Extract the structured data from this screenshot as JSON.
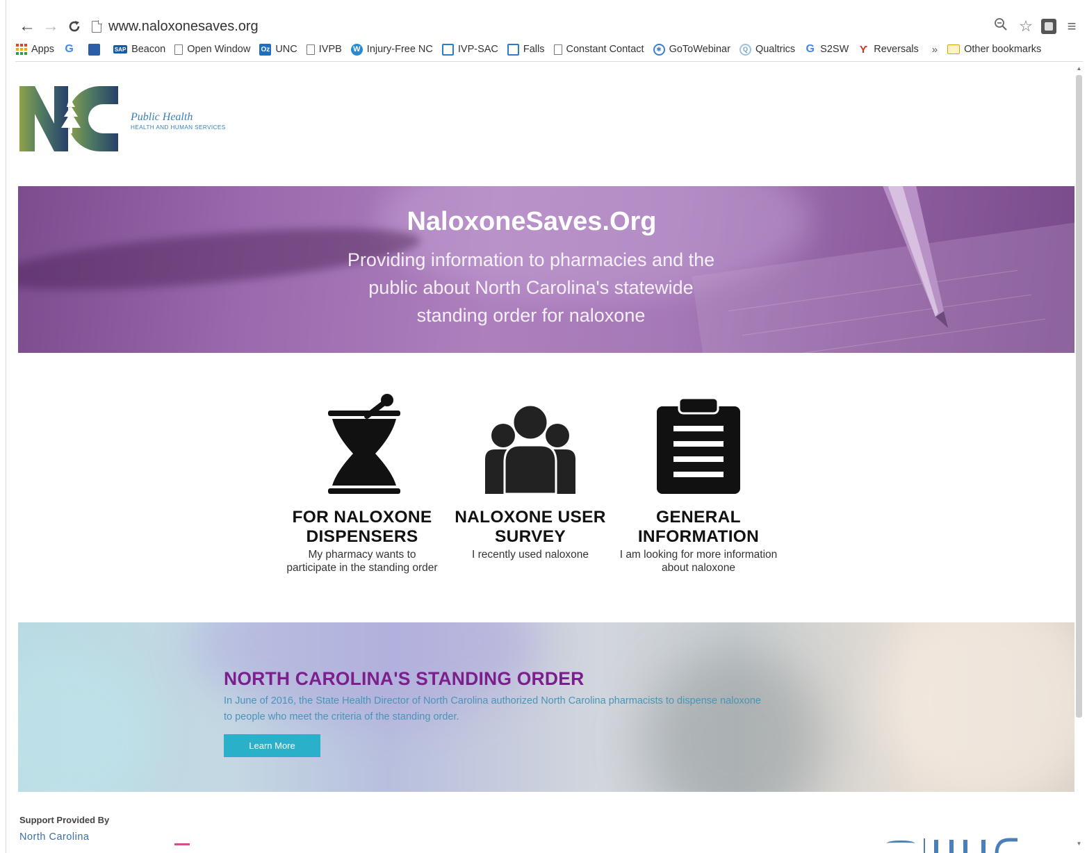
{
  "browser": {
    "url": "www.naloxonesaves.org",
    "bookmarks": [
      {
        "label": "Apps",
        "icon": "apps-grid-icon",
        "color": "#e0452c"
      },
      {
        "label": "",
        "icon": "google-icon",
        "color": "#4285f4"
      },
      {
        "label": "",
        "icon": "news-site-icon",
        "color": "#2a5fa8"
      },
      {
        "label": "Beacon",
        "icon": "sap-icon",
        "color": "#1a5aa0"
      },
      {
        "label": "Open Window",
        "icon": "page-icon",
        "color": "#777777"
      },
      {
        "label": "UNC",
        "icon": "outlook-icon",
        "color": "#1f6fc1"
      },
      {
        "label": "IVPB",
        "icon": "page-icon",
        "color": "#777777"
      },
      {
        "label": "Injury-Free NC",
        "icon": "wordpress-icon",
        "color": "#2a8ad0"
      },
      {
        "label": "IVP-SAC",
        "icon": "calendar-icon",
        "color": "#2b7bd0"
      },
      {
        "label": "Falls",
        "icon": "calendar-icon",
        "color": "#2b7bd0"
      },
      {
        "label": "Constant Contact",
        "icon": "page-icon",
        "color": "#777777"
      },
      {
        "label": "GoToWebinar",
        "icon": "gotowebinar-icon",
        "color": "#3b7fd0"
      },
      {
        "label": "Qualtrics",
        "icon": "qualtrics-icon",
        "color": "#6aa0d8"
      },
      {
        "label": "S2SW",
        "icon": "google-icon",
        "color": "#4285f4"
      },
      {
        "label": "Reversals",
        "icon": "reversals-icon",
        "color": "#d03020"
      }
    ],
    "more_label": "»",
    "other_bookmarks_label": "Other bookmarks"
  },
  "header": {
    "logo_title": "Public Health",
    "logo_subtitle": "HEALTH AND HUMAN SERVICES"
  },
  "hero": {
    "title": "NaloxoneSaves.Org",
    "subtitle": "Providing information to pharmacies and the public about North Carolina's statewide standing order for naloxone"
  },
  "options": [
    {
      "title": "FOR NALOXONE DISPENSERS",
      "description": "My pharmacy wants to participate in the standing order",
      "icon": "mortar-pestle-icon"
    },
    {
      "title": "NALOXONE USER SURVEY",
      "description": "I recently used naloxone",
      "icon": "people-group-icon"
    },
    {
      "title": "GENERAL INFORMATION",
      "description": "I am looking for more information about naloxone",
      "icon": "clipboard-icon"
    }
  ],
  "standing_order": {
    "title": "NORTH CAROLINA'S STANDING ORDER",
    "text": "In June of 2016, the State Health Director of North Carolina authorized North Carolina pharmacists to dispense naloxone to people who meet the criteria of the standing order.",
    "button_label": "Learn More"
  },
  "footer": {
    "support_label": "Support Provided By",
    "support_org": "North Carolina"
  },
  "colors": {
    "hero_purple": "#9b69ad",
    "order_title": "#7b1f8c",
    "order_text": "#4a94b8",
    "button": "#2ab0c9"
  }
}
